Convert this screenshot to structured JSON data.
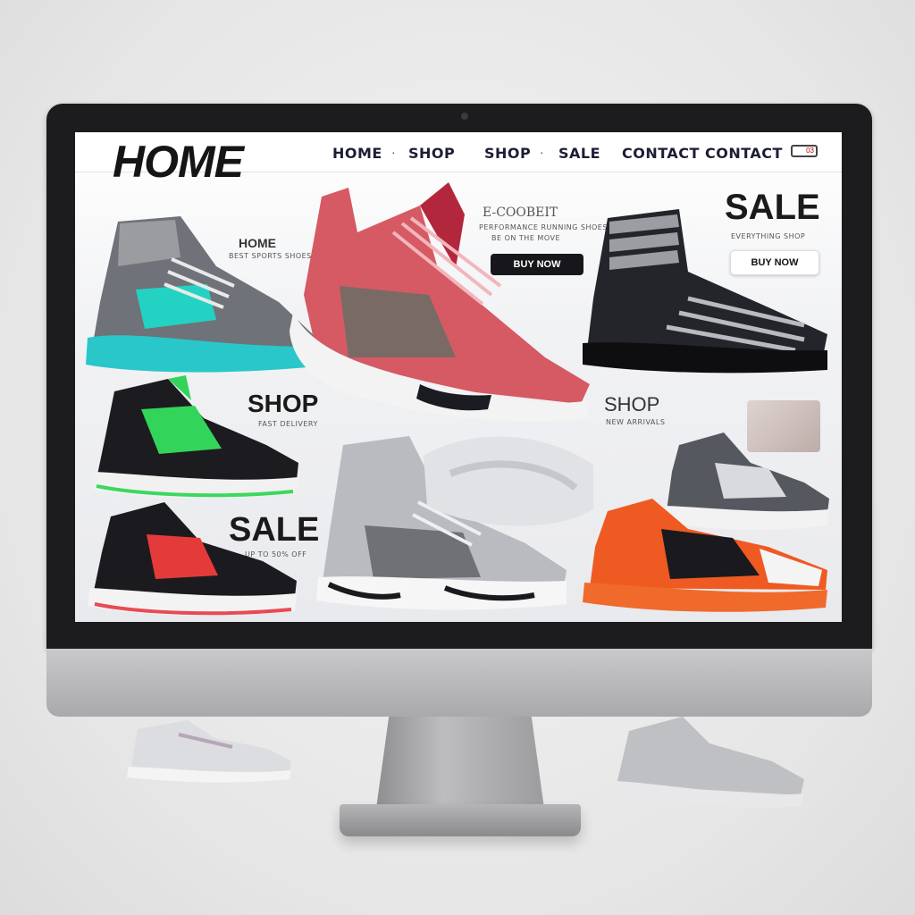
{
  "site": {
    "logo_text": "HOME",
    "nav": [
      "HOME",
      "SHOP",
      "SHOP",
      "SALE",
      "CONTACT",
      "CONTACT"
    ],
    "cart_badge": "03"
  },
  "promos": {
    "home_label": "HOME",
    "home_sub": "BEST SPORTS SHOES",
    "ecommerce_title": "E-COOBEIT",
    "ecommerce_sub_1": "PERFORMANCE RUNNING SHOES",
    "ecommerce_sub_2": "BE ON THE MOVE",
    "buy_now_1": "BUY NOW",
    "sale_title": "SALE",
    "sale_sub": "EVERYTHING SHOP",
    "buy_now_2": "BUY NOW",
    "shop_big": "SHOP",
    "shop_big_sub": "FAST DELIVERY",
    "shop_small": "SHOP",
    "shop_small_sub": "NEW ARRIVALS",
    "sale_big": "SALE",
    "sale_big_sub": "UP TO 50% OFF"
  },
  "colors": {
    "accent_dark": "#17171b",
    "teal": "#2ad3c9",
    "red_pink": "#d9535b",
    "green": "#36d35a",
    "orange": "#f05a23"
  },
  "products": [
    {
      "icon": "sneaker-icon",
      "colorway": "grey-teal"
    },
    {
      "icon": "sneaker-icon",
      "colorway": "red-pink"
    },
    {
      "icon": "sneaker-icon",
      "colorway": "black-white-stripe"
    },
    {
      "icon": "sneaker-icon",
      "colorway": "black-green"
    },
    {
      "icon": "sneaker-icon",
      "colorway": "grey-white"
    },
    {
      "icon": "sneaker-icon",
      "colorway": "red-black"
    },
    {
      "icon": "sneaker-icon",
      "colorway": "grey-white-low"
    },
    {
      "icon": "sneaker-icon",
      "colorway": "orange-black"
    }
  ]
}
